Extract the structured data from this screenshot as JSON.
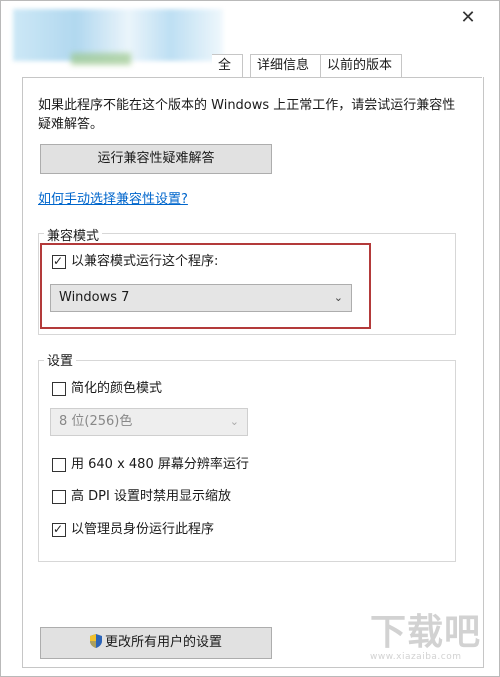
{
  "window": {
    "close_glyph": "✕"
  },
  "tabs": [
    {
      "label": ""
    },
    {
      "label": ""
    },
    {
      "label": "全"
    },
    {
      "label": "详细信息"
    },
    {
      "label": "以前的版本"
    }
  ],
  "intro_text": "如果此程序不能在这个版本的 Windows 上正常工作，请尝试运行兼容性疑难解答。",
  "troubleshoot_button": "运行兼容性疑难解答",
  "manual_link": "如何手动选择兼容性设置?",
  "compat_mode": {
    "legend": "兼容模式",
    "run_in_compat_label": "以兼容模式运行这个程序:",
    "run_in_compat_checked": true,
    "os_selected": "Windows 7"
  },
  "settings": {
    "legend": "设置",
    "reduced_color_label": "简化的颜色模式",
    "reduced_color_checked": false,
    "color_depth_selected": "8 位(256)色",
    "res_640_label": "用 640 x 480 屏幕分辨率运行",
    "res_640_checked": false,
    "high_dpi_label": "高 DPI 设置时禁用显示缩放",
    "high_dpi_checked": false,
    "run_as_admin_label": "以管理员身份运行此程序",
    "run_as_admin_checked": true
  },
  "all_users_button": "更改所有用户的设置",
  "icons": {
    "shield": "uac-shield-icon",
    "chevron": "chevron-down-icon"
  },
  "colors": {
    "accent_link": "#0066cc",
    "highlight_border": "#b33a3a"
  },
  "watermark": {
    "big": "下载吧",
    "small": "www.xiazaiba.com"
  }
}
